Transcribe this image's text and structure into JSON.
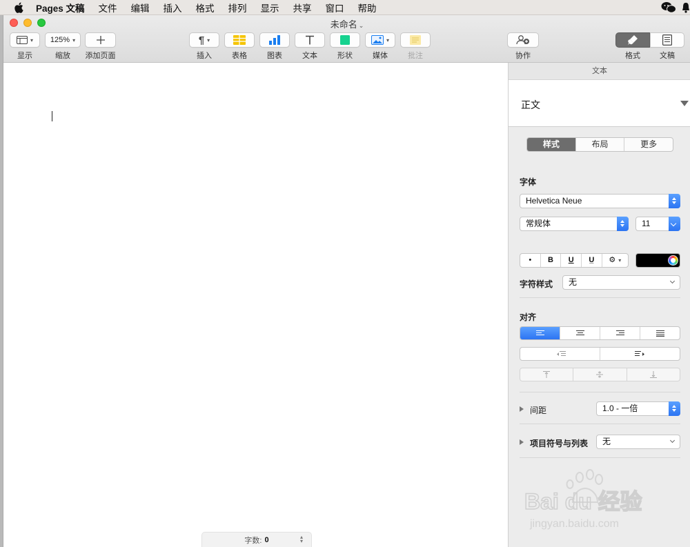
{
  "menubar": {
    "app_name": "Pages 文稿",
    "items": [
      "文件",
      "编辑",
      "插入",
      "格式",
      "排列",
      "显示",
      "共享",
      "窗口",
      "帮助"
    ]
  },
  "window": {
    "title": "未命名"
  },
  "toolbar": {
    "view_label": "显示",
    "zoom_value": "125%",
    "zoom_label": "缩放",
    "add_page_label": "添加页面",
    "insert_label": "插入",
    "table_label": "表格",
    "chart_label": "图表",
    "text_label": "文本",
    "shape_label": "形状",
    "media_label": "媒体",
    "comment_label": "批注",
    "collaborate_label": "协作",
    "format_label": "格式",
    "document_label": "文稿"
  },
  "document": {
    "word_count_label": "字数:",
    "word_count_value": "0"
  },
  "sidebar": {
    "tab_title": "文本",
    "paragraph_style": "正文",
    "segments": [
      "样式",
      "布局",
      "更多"
    ],
    "font_section": "字体",
    "font_family": "Helvetica Neue",
    "font_typeface": "常规体",
    "font_size": "11",
    "format_buttons": [
      "•",
      "B",
      "U",
      "U̲",
      "⚙"
    ],
    "char_style_label": "字符样式",
    "char_style_value": "无",
    "align_section": "对齐",
    "spacing_label": "间距",
    "spacing_value": "1.0 - 一倍",
    "bullets_label": "项目符号与列表",
    "bullets_value": "无"
  },
  "watermark": {
    "brand": "Bai du 经验",
    "url": "jingyan.baidu.com"
  },
  "colors": {
    "accent_blue": "#2c74f2",
    "selected_segment": "#6d6d6d"
  }
}
